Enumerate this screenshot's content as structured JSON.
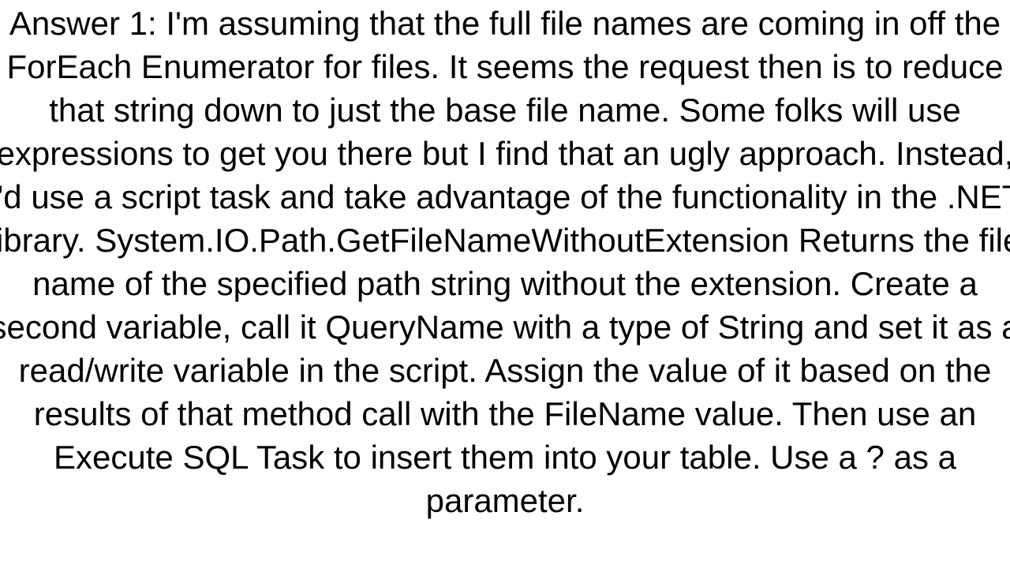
{
  "answer": {
    "text": "Answer 1: I'm assuming that the full file names are coming in off the ForEach Enumerator for files. It seems the request then is to reduce that string down to just the base file name. Some folks will use expressions to get you there but I find that an ugly approach. Instead, I'd use a script task and take advantage of the functionality in the .NET library. System.IO.Path.GetFileNameWithoutExtension  Returns the file name of the specified path string without the extension.  Create a second variable, call it QueryName with a type of String and set it as a read/write variable in the script. Assign the value of it based on the results of that method call with the FileName value. Then use an Execute SQL Task to insert them into your table. Use a ? as a parameter."
  }
}
